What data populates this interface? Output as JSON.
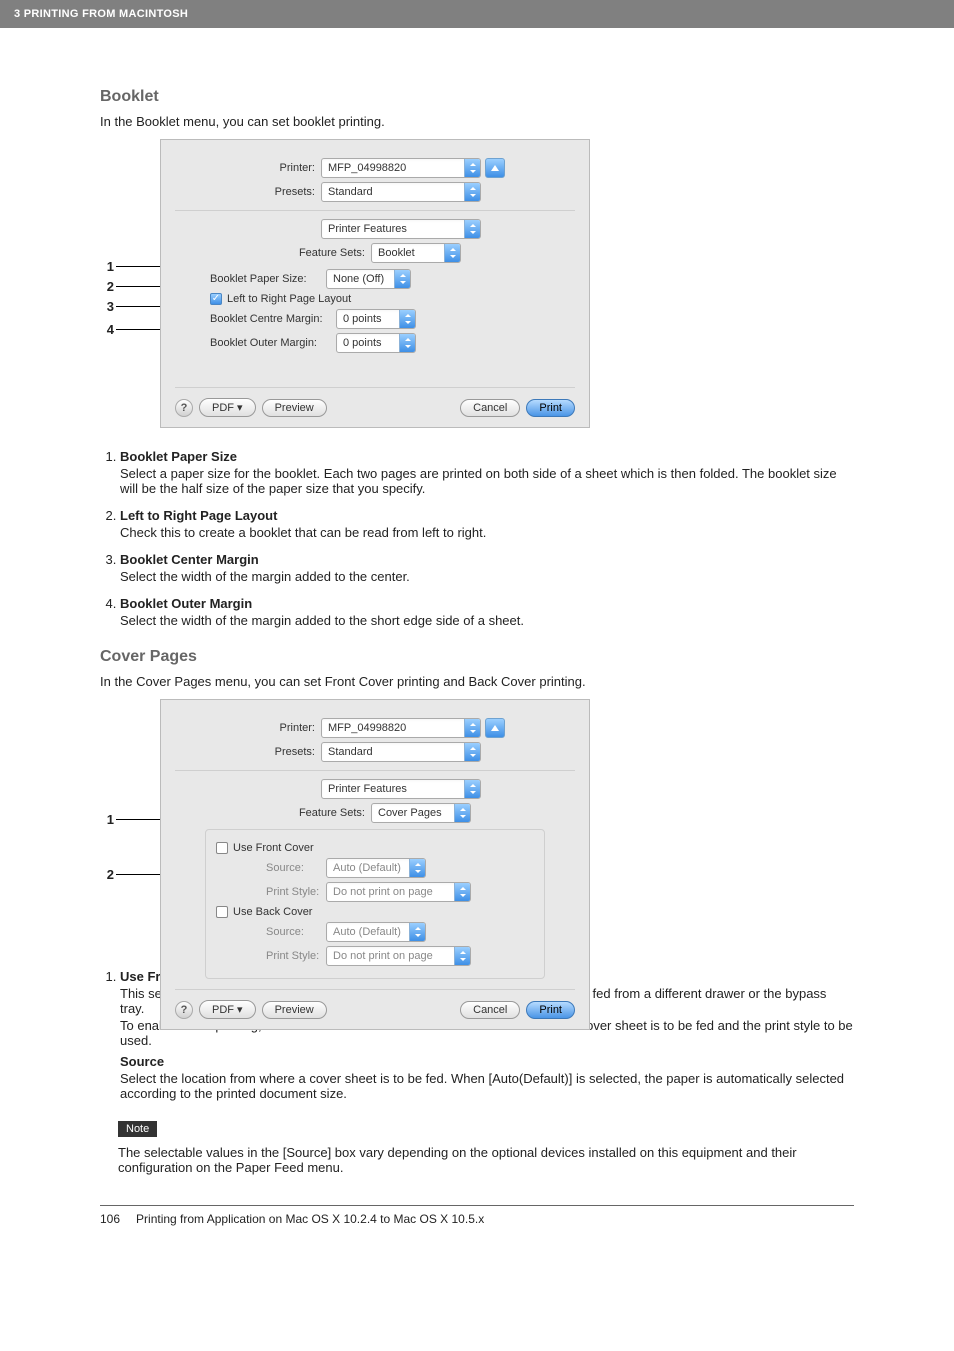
{
  "header": {
    "chapter": "3 PRINTING FROM MACINTOSH"
  },
  "booklet": {
    "title": "Booklet",
    "intro": "In the Booklet menu, you can set booklet printing.",
    "dlg": {
      "printer_label": "Printer:",
      "printer_value": "MFP_04998820",
      "presets_label": "Presets:",
      "presets_value": "Standard",
      "pane_value": "Printer Features",
      "feature_sets_label": "Feature Sets:",
      "feature_sets_value": "Booklet",
      "opt1_label": "Booklet Paper Size:",
      "opt1_value": "None (Off)",
      "opt2_label": "Left to Right Page Layout",
      "opt3_label": "Booklet Centre Margin:",
      "opt3_value": "0 points",
      "opt4_label": "Booklet Outer Margin:",
      "opt4_value": "0 points",
      "pdf_label": "PDF ▾",
      "preview_label": "Preview",
      "cancel_label": "Cancel",
      "print_label": "Print"
    },
    "items": [
      {
        "term": "Booklet Paper Size",
        "body": "Select a paper size for the booklet.  Each two pages are printed on both side of a sheet which is then folded.  The booklet size will be the half size of the paper size that you specify."
      },
      {
        "term": "Left to Right Page Layout",
        "body": "Check this to create a booklet that can be read from left to right."
      },
      {
        "term": "Booklet Center Margin",
        "body": "Select the width of the margin added to the center."
      },
      {
        "term": "Booklet Outer Margin",
        "body": "Select the width of the margin added to the short edge side of a sheet."
      }
    ]
  },
  "cover": {
    "title": "Cover Pages",
    "intro": "In the Cover Pages menu, you can set Front Cover printing and Back Cover printing.",
    "dlg": {
      "printer_label": "Printer:",
      "printer_value": "MFP_04998820",
      "presets_label": "Presets:",
      "presets_value": "Standard",
      "pane_value": "Printer Features",
      "feature_sets_label": "Feature Sets:",
      "feature_sets_value": "Cover Pages",
      "front_label": "Use Front Cover",
      "back_label": "Use Back Cover",
      "source_label": "Source:",
      "source_value": "Auto (Default)",
      "style_label": "Print Style:",
      "style_value": "Do not print on page",
      "pdf_label": "PDF ▾",
      "preview_label": "Preview",
      "cancel_label": "Cancel",
      "print_label": "Print"
    },
    "items": [
      {
        "term": "Use Front Cover",
        "body1": "This sets front cover printing which allows you to insert or print a cover on a sheet fed from a different drawer or the bypass tray.",
        "body2": "To enable cover printing, check on the box and select the location from where a cover sheet is to be fed and the print style to be used.",
        "sub_term": "Source",
        "sub_body": "Select the location from where a cover sheet is to be fed.  When [Auto(Default)] is selected, the paper is automatically selected according to the printed document size."
      }
    ],
    "note_label": "Note",
    "note_text": "The selectable values in the [Source] box vary depending on the optional devices installed on this equipment and their configuration on the Paper Feed menu."
  },
  "footer": {
    "page_number": "106",
    "text": "Printing from Application on Mac OS X 10.2.4 to Mac OS X 10.5.x"
  }
}
